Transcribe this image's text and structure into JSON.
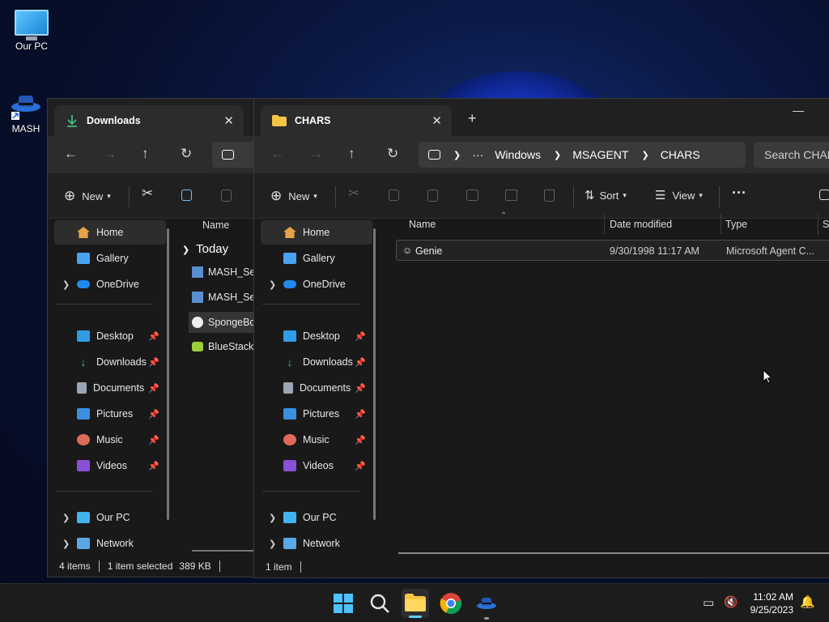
{
  "desktop": {
    "icons": [
      {
        "label": "Our PC"
      },
      {
        "label": "MASH"
      }
    ]
  },
  "downloads_window": {
    "tab_title": "Downloads",
    "cmd": {
      "new_label": "New"
    },
    "sidebar": {
      "home": "Home",
      "gallery": "Gallery",
      "onedrive": "OneDrive",
      "desktop": "Desktop",
      "downloads": "Downloads",
      "documents": "Documents",
      "pictures": "Pictures",
      "music": "Music",
      "videos": "Videos",
      "our_pc": "Our PC",
      "network": "Network"
    },
    "column_name": "Name",
    "group_label": "Today",
    "files": [
      "MASH_Setu",
      "MASH_Setu",
      "SpongeBol",
      "BlueStacks"
    ],
    "status": {
      "items": "4 items",
      "selected": "1 item selected",
      "size": "389 KB"
    }
  },
  "chars_window": {
    "tab_title": "CHARS",
    "breadcrumb": {
      "more": "···",
      "parts": [
        "Windows",
        "MSAGENT",
        "CHARS"
      ]
    },
    "search_placeholder": "Search CHARS",
    "cmd": {
      "new_label": "New",
      "sort_label": "Sort",
      "view_label": "View",
      "more": "···"
    },
    "sidebar": {
      "home": "Home",
      "gallery": "Gallery",
      "onedrive": "OneDrive",
      "desktop": "Desktop",
      "downloads": "Downloads",
      "documents": "Documents",
      "pictures": "Pictures",
      "music": "Music",
      "videos": "Videos",
      "our_pc": "Our PC",
      "network": "Network"
    },
    "columns": {
      "name": "Name",
      "date": "Date modified",
      "type": "Type",
      "size": "Si"
    },
    "rows": [
      {
        "name": "Genie",
        "date": "9/30/1998 11:17 AM",
        "type": "Microsoft Agent C..."
      }
    ],
    "status": {
      "items": "1 item"
    }
  },
  "taskbar": {
    "time": "11:02 AM",
    "date": "9/25/2023"
  },
  "colors": {
    "accent": "#60cdff",
    "folder_yellow": "#f4c542",
    "download_green": "#3fbf7f"
  }
}
